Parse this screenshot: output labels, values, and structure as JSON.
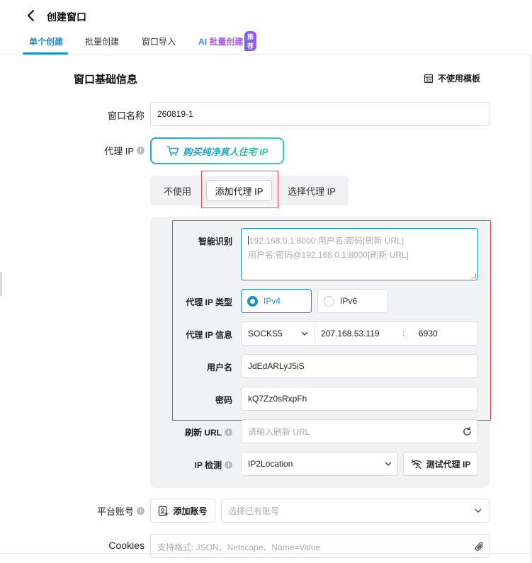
{
  "header": {
    "title": "创建窗口",
    "tabs": [
      {
        "label": "单个创建",
        "active": true
      },
      {
        "label": "批量创建"
      },
      {
        "label": "窗口导入"
      }
    ],
    "ai_tab": {
      "prefix": "AI ",
      "label": "批量创建",
      "badge": "推荐"
    }
  },
  "section": {
    "title": "窗口基础信息",
    "template_label": "不使用模板"
  },
  "window_name": {
    "label": "窗口名称",
    "value": "260819-1"
  },
  "proxy": {
    "label": "代理 IP",
    "buy_label": "购买纯净真人住宅 IP",
    "modes": [
      "不使用",
      "添加代理 IP",
      "选择代理 IP"
    ],
    "active_mode": "添加代理 IP",
    "smart": {
      "label": "智能识别",
      "placeholder_line1": "192.168.0.1:8000:用户名:密码[刷新 URL]",
      "placeholder_line2": "用户名:密码@192.168.0.1:8000[刷新 URL]"
    },
    "type": {
      "label": "代理 IP 类型",
      "options": [
        "IPv4",
        "IPv6"
      ],
      "selected": "IPv4"
    },
    "info": {
      "label": "代理 IP 信息",
      "protocol": "SOCKS5",
      "host": "207.168.53.119",
      "separator": ":",
      "port": "6930"
    },
    "username": {
      "label": "用户名",
      "value": "JdEdARLyJ5iS"
    },
    "password": {
      "label": "密码",
      "value": "kQ7Zz0sRxpFh"
    },
    "refresh_url": {
      "label": "刷新 URL",
      "placeholder": "请输入刷新 URL"
    },
    "ip_check": {
      "label": "IP 检测",
      "value": "IP2Location",
      "test_button": "测试代理 IP"
    }
  },
  "platform": {
    "label": "平台账号",
    "add_button": "添加账号",
    "select_placeholder": "选择已有账号"
  },
  "cookies": {
    "label": "Cookies",
    "placeholder": "支持格式: JSON、Netscape、Name=Value"
  },
  "colors": {
    "accent": "#1a8fd1",
    "highlight_border": "#e5484d",
    "panel_bg": "#f0f2f5"
  }
}
